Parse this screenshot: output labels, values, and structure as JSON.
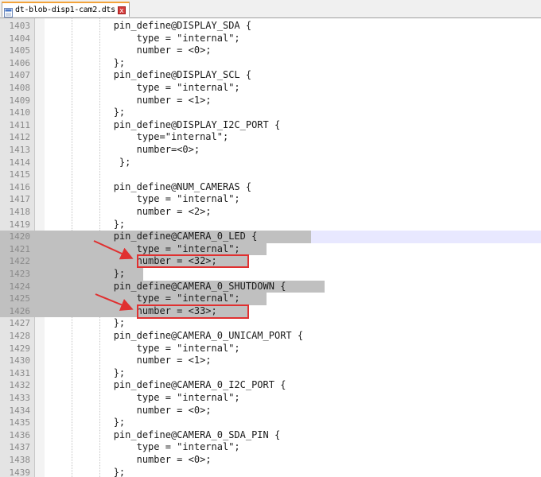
{
  "tab": {
    "title": "dt-blob-disp1-cam2.dts",
    "close_label": "x"
  },
  "colors": {
    "selection": "#c0c0c0",
    "current_line": "#e8e8ff",
    "annotation_red": "#e03030"
  },
  "lines": [
    {
      "num": "1403",
      "text": "            pin_define@DISPLAY_SDA {"
    },
    {
      "num": "1404",
      "text": "                type = \"internal\";"
    },
    {
      "num": "1405",
      "text": "                number = <0>;"
    },
    {
      "num": "1406",
      "text": "            };"
    },
    {
      "num": "1407",
      "text": "            pin_define@DISPLAY_SCL {"
    },
    {
      "num": "1408",
      "text": "                type = \"internal\";"
    },
    {
      "num": "1409",
      "text": "                number = <1>;"
    },
    {
      "num": "1410",
      "text": "            };"
    },
    {
      "num": "1411",
      "text": "            pin_define@DISPLAY_I2C_PORT {"
    },
    {
      "num": "1412",
      "text": "                type=\"internal\";"
    },
    {
      "num": "1413",
      "text": "                number=<0>;"
    },
    {
      "num": "1414",
      "text": "             };"
    },
    {
      "num": "1415",
      "text": ""
    },
    {
      "num": "1416",
      "text": "            pin_define@NUM_CAMERAS {"
    },
    {
      "num": "1417",
      "text": "                type = \"internal\";"
    },
    {
      "num": "1418",
      "text": "                number = <2>;"
    },
    {
      "num": "1419",
      "text": "            };"
    },
    {
      "num": "1420",
      "text": "            pin_define@CAMERA_0_LED {"
    },
    {
      "num": "1421",
      "text": "                type = \"internal\";"
    },
    {
      "num": "1422",
      "text": "                number = <32>;"
    },
    {
      "num": "1423",
      "text": "            };"
    },
    {
      "num": "1424",
      "text": "            pin_define@CAMERA_0_SHUTDOWN {"
    },
    {
      "num": "1425",
      "text": "                type = \"internal\";"
    },
    {
      "num": "1426",
      "text": "                number = <33>;"
    },
    {
      "num": "1427",
      "text": "            };"
    },
    {
      "num": "1428",
      "text": "            pin_define@CAMERA_0_UNICAM_PORT {"
    },
    {
      "num": "1429",
      "text": "                type = \"internal\";"
    },
    {
      "num": "1430",
      "text": "                number = <1>;"
    },
    {
      "num": "1431",
      "text": "            };"
    },
    {
      "num": "1432",
      "text": "            pin_define@CAMERA_0_I2C_PORT {"
    },
    {
      "num": "1433",
      "text": "                type = \"internal\";"
    },
    {
      "num": "1434",
      "text": "                number = <0>;"
    },
    {
      "num": "1435",
      "text": "            };"
    },
    {
      "num": "1436",
      "text": "            pin_define@CAMERA_0_SDA_PIN {"
    },
    {
      "num": "1437",
      "text": "                type = \"internal\";"
    },
    {
      "num": "1438",
      "text": "                number = <0>;"
    },
    {
      "num": "1439",
      "text": "            };"
    }
  ]
}
